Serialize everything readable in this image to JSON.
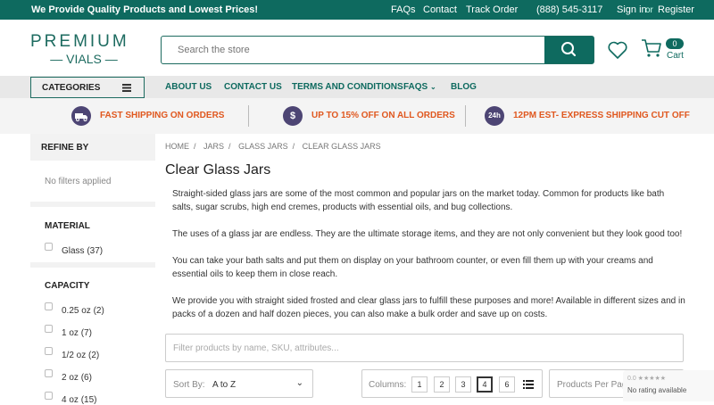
{
  "topbar": {
    "promo": "We Provide Quality Products and Lowest Prices!",
    "faqs": "FAQs",
    "contact": "Contact",
    "track_order": "Track Order",
    "phone": "(888) 545-3117",
    "sign_in": "Sign in",
    "or": "or",
    "register": "Register"
  },
  "logo": {
    "line1": "PREMIUM",
    "line2": "VIALS"
  },
  "search": {
    "placeholder": "Search the store"
  },
  "cart": {
    "count": "0",
    "label": "Cart"
  },
  "nav": {
    "categories": "CATEGORIES",
    "items": [
      "ABOUT US",
      "CONTACT US",
      "TERMS AND CONDITIONS",
      "FAQS",
      "BLOG"
    ]
  },
  "perks": [
    {
      "icon": "truck-icon",
      "text": "FAST SHIPPING ON ORDERS"
    },
    {
      "icon": "dollar-icon",
      "text": "UP TO 15% OFF ON ALL ORDERS"
    },
    {
      "icon": "24h-icon",
      "icon_text": "24h",
      "text": "12PM EST- EXPRESS SHIPPING CUT OFF"
    }
  ],
  "sidebar": {
    "refine": "REFINE BY",
    "no_filters": "No filters applied",
    "material": {
      "title": "MATERIAL",
      "options": [
        {
          "label": "Glass",
          "count": "(37)"
        }
      ]
    },
    "capacity": {
      "title": "CAPACITY",
      "options": [
        {
          "label": "0.25 oz",
          "count": "(2)"
        },
        {
          "label": "1 oz",
          "count": "(7)"
        },
        {
          "label": "1/2 oz",
          "count": "(2)"
        },
        {
          "label": "2 oz",
          "count": "(6)"
        },
        {
          "label": "4 oz",
          "count": "(15)"
        }
      ]
    }
  },
  "breadcrumb": [
    "HOME",
    "JARS",
    "GLASS JARS",
    "CLEAR GLASS JARS"
  ],
  "page_title": "Clear Glass Jars",
  "description": [
    "Straight-sided glass jars are some of the most common and popular jars on the market today. Common for products like bath salts, sugar scrubs, high end cremes, products with essential oils, and bug collections.",
    "The uses of a glass jar are endless. They are the ultimate storage items, and they are not only convenient but they look good too!",
    "You can take your bath salts and put them on display on your bathroom counter, or even fill them up with your creams and essential oils to keep them in close reach.",
    "We provide you with straight sided frosted and clear glass jars to fulfill these purposes and more! Available in different sizes and in packs of a dozen and half dozen pieces, you can also make a bulk order and save up on costs."
  ],
  "filter": {
    "placeholder": "Filter products by name, SKU, attributes..."
  },
  "sort": {
    "label": "Sort By:",
    "value": "A to Z"
  },
  "columns": {
    "label": "Columns:",
    "options": [
      "1",
      "2",
      "3",
      "4",
      "6"
    ],
    "active": "4"
  },
  "per_page": {
    "label": "Products Per Page"
  },
  "rating_widget": {
    "stars": "0.0 ★★★★★",
    "text": "No rating available"
  },
  "colors": {
    "brand": "#0e6a5f",
    "accent": "#e0581f",
    "perk_icon": "#4d4574"
  }
}
